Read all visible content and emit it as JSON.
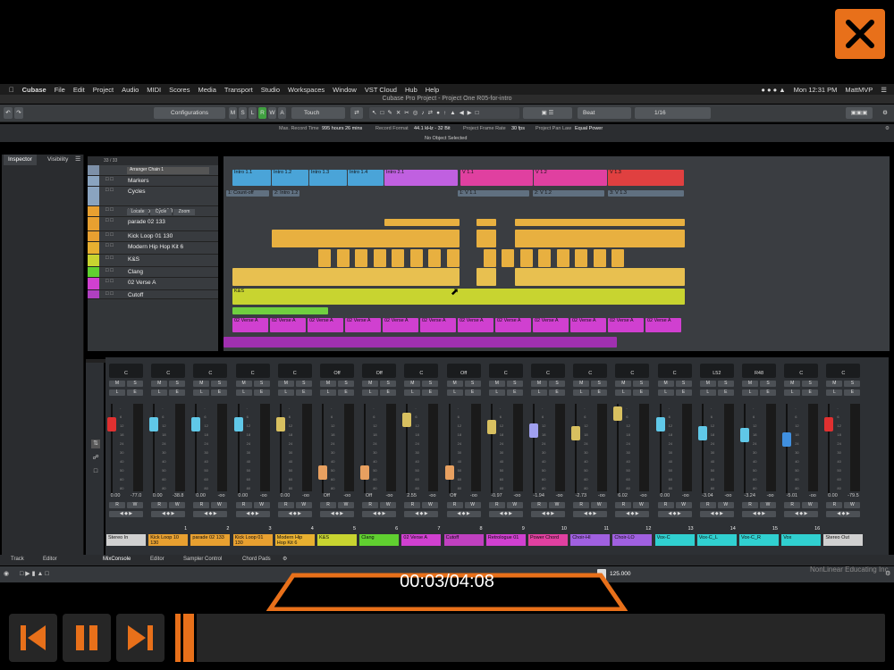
{
  "mac_menu": [
    "Cubase",
    "File",
    "Edit",
    "Project",
    "Audio",
    "MIDI",
    "Scores",
    "Media",
    "Transport",
    "Studio",
    "Workspaces",
    "Window",
    "VST Cloud",
    "Hub",
    "Help"
  ],
  "clock": "Mon 12:31 PM",
  "user": "MattMVP",
  "window_title": "Cubase Pro Project - Project One R05-for-intro",
  "toolbar": {
    "configurations": "Configurations",
    "automation_mode": "Touch",
    "modes": [
      "M",
      "S",
      "L",
      "R",
      "W",
      "A"
    ],
    "snap": "Beat",
    "quantize": "1/16"
  },
  "info_line": {
    "max_record_time_label": "Max. Record Time",
    "max_record_time": "995 hours 26 mins",
    "record_format_label": "Record Format",
    "record_format": "44.1 kHz - 32 Bit",
    "frame_rate_label": "Project Frame Rate",
    "frame_rate": "30 fps",
    "pan_law_label": "Project Pan Law",
    "pan_law": "Equal Power",
    "no_object": "No Object Selected"
  },
  "inspector": {
    "tabs": [
      "Inspector",
      "Visibility"
    ],
    "counter": "33 / 33",
    "chord_track": "Arranger Chain 1"
  },
  "tracks": [
    {
      "name": "Markers",
      "color": "#8aa4c0"
    },
    {
      "name": "Cycles",
      "color": "#8aa4c0"
    },
    {
      "name": "Kick Loop 10 130",
      "color": "#e8a030"
    },
    {
      "name": "parade 02 133",
      "color": "#e8a030"
    },
    {
      "name": "Kick Loop 01 130",
      "color": "#e8a030"
    },
    {
      "name": "Modern Hip Hop Kit 6",
      "color": "#e8b030"
    },
    {
      "name": "K&S",
      "color": "#c8d430"
    },
    {
      "name": "Clang",
      "color": "#60d030"
    },
    {
      "name": "02 Verse A",
      "color": "#d040d0"
    },
    {
      "name": "Cutoff",
      "color": "#b040c0"
    }
  ],
  "cycle_buttons": [
    "Locate",
    "Cycle",
    "Zoom"
  ],
  "ruler": [
    "1",
    "3",
    "5",
    "7",
    "9",
    "11",
    "13",
    "15",
    "17",
    "19",
    "21",
    "23",
    "25",
    "27",
    "29",
    "31",
    "33",
    "35",
    "37",
    "39",
    "41",
    "43",
    "45",
    "47",
    "49",
    "51",
    "53",
    "55",
    "57",
    "59",
    "61",
    "63",
    "65",
    "67",
    "69"
  ],
  "arranger_clips": [
    "Intro 1.1",
    "Intro 1.2",
    "Intro 1.3",
    "Intro 1.4",
    "Intro 2.1",
    "V 1.1",
    "V 1.2",
    "V 1.3"
  ],
  "marker_clips": [
    "1: Count-off",
    "2: Intro 1.2",
    "1: V 1.1",
    "2: V 1.2",
    "3: V 1.3"
  ],
  "ks_label": "K&S",
  "verse_label": "02 Verse A",
  "mixer": [
    {
      "pan": "C",
      "value": "0.00",
      "peak": "-77.0",
      "name": "Stereo In",
      "num": "",
      "color": "#d0d0d0",
      "cap": "#e03030"
    },
    {
      "pan": "C",
      "value": "0.00",
      "peak": "-38.8",
      "name": "Kick Loop 10 130",
      "num": "1",
      "color": "#e8a030",
      "cap": "#60c8e8"
    },
    {
      "pan": "C",
      "value": "0.00",
      "peak": "-oo",
      "name": "parade 02 133",
      "num": "2",
      "color": "#e8a030",
      "cap": "#60c8e8"
    },
    {
      "pan": "C",
      "value": "0.00",
      "peak": "-oo",
      "name": "Kick Loop 01 130",
      "num": "3",
      "color": "#e8a030",
      "cap": "#60c8e8"
    },
    {
      "pan": "C",
      "value": "0.00",
      "peak": "-oo",
      "name": "Modern Hip Hop Kit 6",
      "num": "4",
      "color": "#e8b030",
      "cap": "#d8c060"
    },
    {
      "pan": "Off",
      "value": "Off",
      "peak": "-oo",
      "name": "K&S",
      "num": "5",
      "color": "#c8d430",
      "cap": "#e8a060"
    },
    {
      "pan": "Off",
      "value": "Off",
      "peak": "-oo",
      "name": "Clang",
      "num": "6",
      "color": "#60d030",
      "cap": "#e8a060"
    },
    {
      "pan": "C",
      "value": "2.55",
      "peak": "-oo",
      "name": "02 Verse A",
      "num": "7",
      "color": "#d040d0",
      "cap": "#d8c060"
    },
    {
      "pan": "Off",
      "value": "Off",
      "peak": "-oo",
      "name": "Cutoff",
      "num": "8",
      "color": "#c040c0",
      "cap": "#e8a060"
    },
    {
      "pan": "C",
      "value": "-0.97",
      "peak": "-oo",
      "name": "Retrologue 01",
      "num": "9",
      "color": "#d040d0",
      "cap": "#d8c060"
    },
    {
      "pan": "C",
      "value": "-1.94",
      "peak": "-oo",
      "name": "Power Chord",
      "num": "10",
      "color": "#e040a0",
      "cap": "#a0a0f0"
    },
    {
      "pan": "C",
      "value": "-2.73",
      "peak": "-oo",
      "name": "Choir-HI",
      "num": "11",
      "color": "#a060e0",
      "cap": "#d8c060"
    },
    {
      "pan": "C",
      "value": "6.02",
      "peak": "-oo",
      "name": "Choir-LO",
      "num": "12",
      "color": "#a060e0",
      "cap": "#d8c060"
    },
    {
      "pan": "C",
      "value": "0.00",
      "peak": "-oo",
      "name": "Vox-C",
      "num": "13",
      "color": "#30d0d0",
      "cap": "#60c8e8"
    },
    {
      "pan": "L52",
      "value": "-3.04",
      "peak": "-oo",
      "name": "Vox-C_L",
      "num": "14",
      "color": "#30d0d0",
      "cap": "#60c8e8"
    },
    {
      "pan": "R48",
      "value": "-3.24",
      "peak": "-oo",
      "name": "Vox-C_R",
      "num": "15",
      "color": "#30d0d0",
      "cap": "#60c8e8"
    },
    {
      "pan": "C",
      "value": "-5.01",
      "peak": "-oo",
      "name": "Vox",
      "num": "16",
      "color": "#30d0d0",
      "cap": "#4090e0"
    },
    {
      "pan": "C",
      "value": "0.00",
      "peak": "-79.5",
      "name": "Stereo Out",
      "num": "",
      "color": "#d0d0d0",
      "cap": "#e03030"
    }
  ],
  "fader_levels": [
    0.82,
    0.82,
    0.82,
    0.82,
    0.82,
    0.18,
    0.18,
    0.88,
    0.18,
    0.78,
    0.74,
    0.7,
    0.96,
    0.82,
    0.7,
    0.68,
    0.62,
    0.82
  ],
  "bottom_tabs": [
    "Track",
    "Editor",
    "MixConsole",
    "Editor",
    "Sampler Control",
    "Chord Pads"
  ],
  "tempo": "125.000",
  "playback": {
    "time": "00:03/04:08",
    "progress": 0.012
  },
  "watermark": "NonLinear Educating Inc."
}
